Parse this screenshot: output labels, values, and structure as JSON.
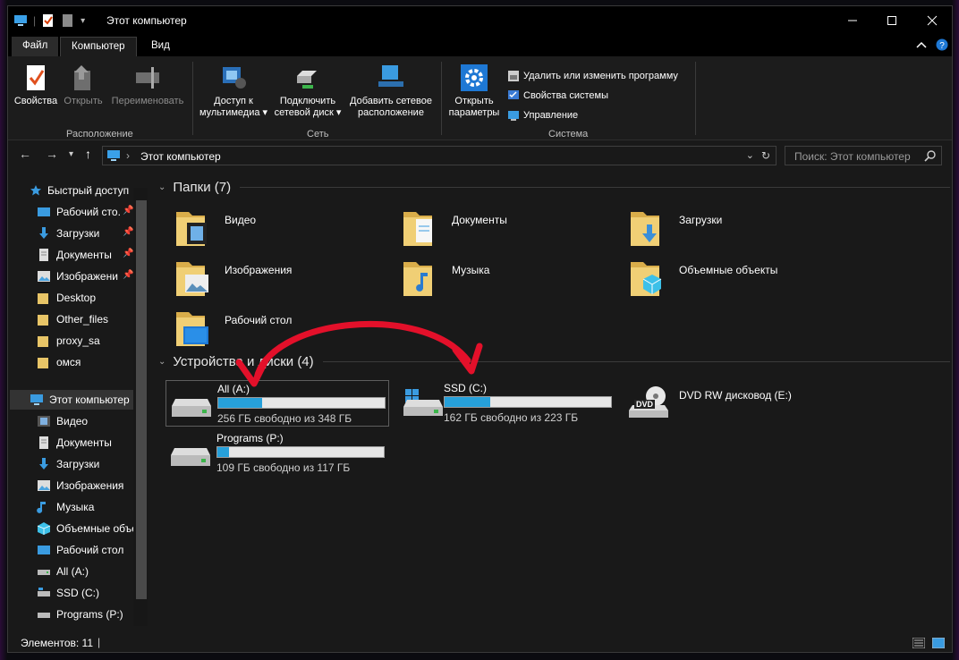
{
  "window": {
    "title": "Этот компьютер"
  },
  "ribbon_tabs": [
    "Файл",
    "Компьютер",
    "Вид"
  ],
  "ribbon": {
    "location": {
      "label": "Расположение",
      "buttons": [
        "Свойства",
        "Открыть",
        "Переименовать"
      ]
    },
    "network": {
      "label": "Сеть",
      "buttons": [
        {
          "line1": "Доступ к",
          "line2": "мультимедиа ▾"
        },
        {
          "line1": "Подключить",
          "line2": "сетевой диск ▾"
        },
        {
          "line1": "Добавить сетевое",
          "line2": "расположение"
        }
      ]
    },
    "system": {
      "label": "Система",
      "open_params": {
        "line1": "Открыть",
        "line2": "параметры"
      },
      "items": [
        "Удалить или изменить программу",
        "Свойства системы",
        "Управление"
      ]
    }
  },
  "address": {
    "path": "Этот компьютер",
    "search_placeholder": "Поиск: Этот компьютер"
  },
  "sidebar": {
    "items": [
      {
        "label": "Быстрый доступ",
        "icon": "star-icon"
      },
      {
        "label": "Рабочий сто.",
        "icon": "desktop-icon"
      },
      {
        "label": "Загрузки",
        "icon": "download-icon"
      },
      {
        "label": "Документы",
        "icon": "document-icon"
      },
      {
        "label": "Изображени",
        "icon": "pictures-icon"
      },
      {
        "label": "Desktop",
        "icon": "folder-icon"
      },
      {
        "label": "Other_files",
        "icon": "folder-icon"
      },
      {
        "label": "proxy_sa",
        "icon": "folder-icon"
      },
      {
        "label": "омся",
        "icon": "folder-icon"
      },
      {
        "label": "Этот компьютер",
        "icon": "computer-icon"
      },
      {
        "label": "Видео",
        "icon": "video-icon"
      },
      {
        "label": "Документы",
        "icon": "document-icon"
      },
      {
        "label": "Загрузки",
        "icon": "download-icon"
      },
      {
        "label": "Изображения",
        "icon": "pictures-icon"
      },
      {
        "label": "Музыка",
        "icon": "music-icon"
      },
      {
        "label": "Объемные объе",
        "icon": "3d-objects-icon"
      },
      {
        "label": "Рабочий стол",
        "icon": "desktop-icon"
      },
      {
        "label": "All (A:)",
        "icon": "drive-icon"
      },
      {
        "label": "SSD (C:)",
        "icon": "drive-icon"
      },
      {
        "label": "Programs (P:)",
        "icon": "drive-icon"
      }
    ]
  },
  "main": {
    "folders_header": "Папки (7)",
    "folders": [
      "Видео",
      "Документы",
      "Загрузки",
      "Изображения",
      "Музыка",
      "Объемные объекты",
      "Рабочий стол"
    ],
    "devices_header": "Устройства и диски (4)",
    "drives": [
      {
        "name": "All (A:)",
        "free": "256 ГБ свободно из 348 ГБ",
        "used_fraction": 0.264
      },
      {
        "name": "SSD (C:)",
        "free": "162 ГБ свободно из 223 ГБ",
        "used_fraction": 0.274
      },
      {
        "name": "DVD RW дисковод (E:)",
        "free": "",
        "used_fraction": null,
        "badge": "DVD"
      },
      {
        "name": "Programs (P:)",
        "free": "109 ГБ свободно из 117 ГБ",
        "used_fraction": 0.068
      }
    ]
  },
  "status": {
    "items_count": "Элементов: 11"
  },
  "colors": {
    "accent": "#26a0da",
    "folder": "#e8c567",
    "arrow": "#e3102a",
    "icon_blue": "#3aa0e8"
  }
}
